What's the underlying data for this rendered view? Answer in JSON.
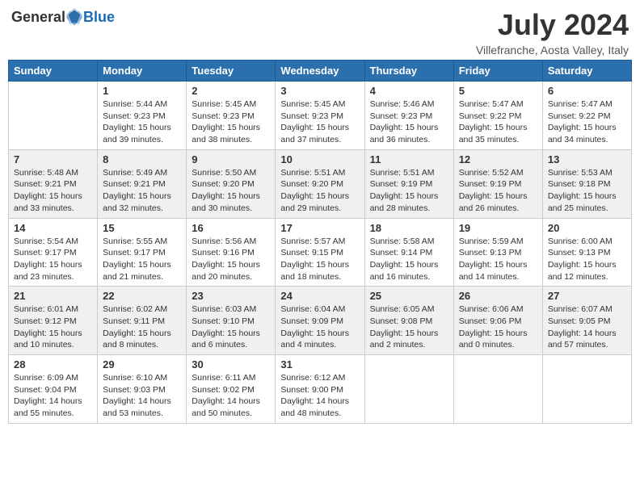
{
  "header": {
    "logo_general": "General",
    "logo_blue": "Blue",
    "month_year": "July 2024",
    "location": "Villefranche, Aosta Valley, Italy"
  },
  "weekdays": [
    "Sunday",
    "Monday",
    "Tuesday",
    "Wednesday",
    "Thursday",
    "Friday",
    "Saturday"
  ],
  "weeks": [
    [
      {
        "day": "",
        "info": ""
      },
      {
        "day": "1",
        "info": "Sunrise: 5:44 AM\nSunset: 9:23 PM\nDaylight: 15 hours\nand 39 minutes."
      },
      {
        "day": "2",
        "info": "Sunrise: 5:45 AM\nSunset: 9:23 PM\nDaylight: 15 hours\nand 38 minutes."
      },
      {
        "day": "3",
        "info": "Sunrise: 5:45 AM\nSunset: 9:23 PM\nDaylight: 15 hours\nand 37 minutes."
      },
      {
        "day": "4",
        "info": "Sunrise: 5:46 AM\nSunset: 9:23 PM\nDaylight: 15 hours\nand 36 minutes."
      },
      {
        "day": "5",
        "info": "Sunrise: 5:47 AM\nSunset: 9:22 PM\nDaylight: 15 hours\nand 35 minutes."
      },
      {
        "day": "6",
        "info": "Sunrise: 5:47 AM\nSunset: 9:22 PM\nDaylight: 15 hours\nand 34 minutes."
      }
    ],
    [
      {
        "day": "7",
        "info": "Sunrise: 5:48 AM\nSunset: 9:21 PM\nDaylight: 15 hours\nand 33 minutes."
      },
      {
        "day": "8",
        "info": "Sunrise: 5:49 AM\nSunset: 9:21 PM\nDaylight: 15 hours\nand 32 minutes."
      },
      {
        "day": "9",
        "info": "Sunrise: 5:50 AM\nSunset: 9:20 PM\nDaylight: 15 hours\nand 30 minutes."
      },
      {
        "day": "10",
        "info": "Sunrise: 5:51 AM\nSunset: 9:20 PM\nDaylight: 15 hours\nand 29 minutes."
      },
      {
        "day": "11",
        "info": "Sunrise: 5:51 AM\nSunset: 9:19 PM\nDaylight: 15 hours\nand 28 minutes."
      },
      {
        "day": "12",
        "info": "Sunrise: 5:52 AM\nSunset: 9:19 PM\nDaylight: 15 hours\nand 26 minutes."
      },
      {
        "day": "13",
        "info": "Sunrise: 5:53 AM\nSunset: 9:18 PM\nDaylight: 15 hours\nand 25 minutes."
      }
    ],
    [
      {
        "day": "14",
        "info": "Sunrise: 5:54 AM\nSunset: 9:17 PM\nDaylight: 15 hours\nand 23 minutes."
      },
      {
        "day": "15",
        "info": "Sunrise: 5:55 AM\nSunset: 9:17 PM\nDaylight: 15 hours\nand 21 minutes."
      },
      {
        "day": "16",
        "info": "Sunrise: 5:56 AM\nSunset: 9:16 PM\nDaylight: 15 hours\nand 20 minutes."
      },
      {
        "day": "17",
        "info": "Sunrise: 5:57 AM\nSunset: 9:15 PM\nDaylight: 15 hours\nand 18 minutes."
      },
      {
        "day": "18",
        "info": "Sunrise: 5:58 AM\nSunset: 9:14 PM\nDaylight: 15 hours\nand 16 minutes."
      },
      {
        "day": "19",
        "info": "Sunrise: 5:59 AM\nSunset: 9:13 PM\nDaylight: 15 hours\nand 14 minutes."
      },
      {
        "day": "20",
        "info": "Sunrise: 6:00 AM\nSunset: 9:13 PM\nDaylight: 15 hours\nand 12 minutes."
      }
    ],
    [
      {
        "day": "21",
        "info": "Sunrise: 6:01 AM\nSunset: 9:12 PM\nDaylight: 15 hours\nand 10 minutes."
      },
      {
        "day": "22",
        "info": "Sunrise: 6:02 AM\nSunset: 9:11 PM\nDaylight: 15 hours\nand 8 minutes."
      },
      {
        "day": "23",
        "info": "Sunrise: 6:03 AM\nSunset: 9:10 PM\nDaylight: 15 hours\nand 6 minutes."
      },
      {
        "day": "24",
        "info": "Sunrise: 6:04 AM\nSunset: 9:09 PM\nDaylight: 15 hours\nand 4 minutes."
      },
      {
        "day": "25",
        "info": "Sunrise: 6:05 AM\nSunset: 9:08 PM\nDaylight: 15 hours\nand 2 minutes."
      },
      {
        "day": "26",
        "info": "Sunrise: 6:06 AM\nSunset: 9:06 PM\nDaylight: 15 hours\nand 0 minutes."
      },
      {
        "day": "27",
        "info": "Sunrise: 6:07 AM\nSunset: 9:05 PM\nDaylight: 14 hours\nand 57 minutes."
      }
    ],
    [
      {
        "day": "28",
        "info": "Sunrise: 6:09 AM\nSunset: 9:04 PM\nDaylight: 14 hours\nand 55 minutes."
      },
      {
        "day": "29",
        "info": "Sunrise: 6:10 AM\nSunset: 9:03 PM\nDaylight: 14 hours\nand 53 minutes."
      },
      {
        "day": "30",
        "info": "Sunrise: 6:11 AM\nSunset: 9:02 PM\nDaylight: 14 hours\nand 50 minutes."
      },
      {
        "day": "31",
        "info": "Sunrise: 6:12 AM\nSunset: 9:00 PM\nDaylight: 14 hours\nand 48 minutes."
      },
      {
        "day": "",
        "info": ""
      },
      {
        "day": "",
        "info": ""
      },
      {
        "day": "",
        "info": ""
      }
    ]
  ]
}
